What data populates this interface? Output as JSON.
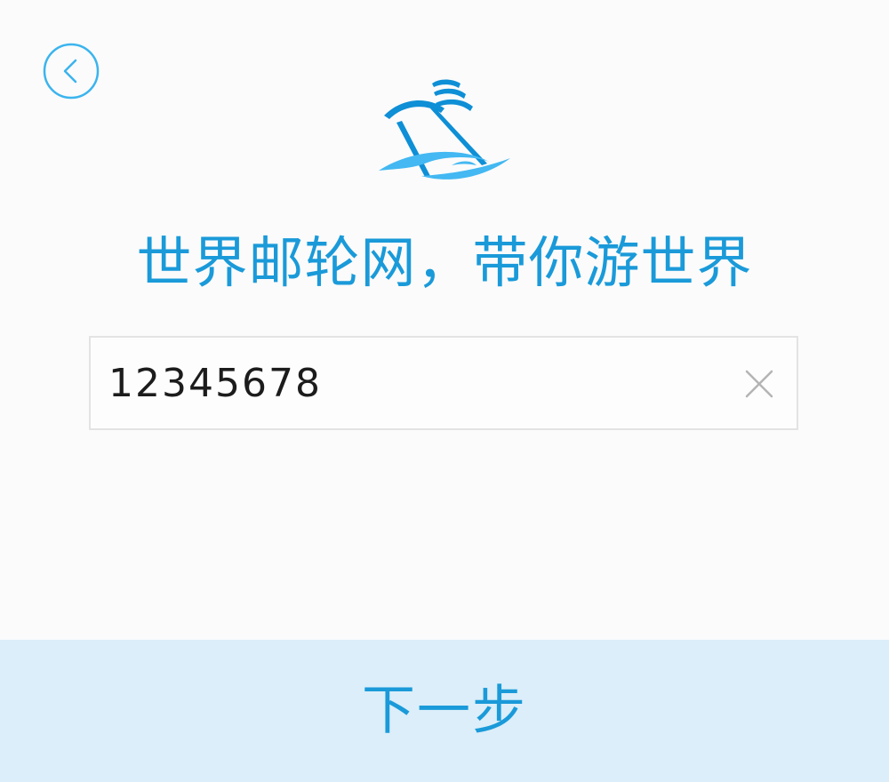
{
  "theme": {
    "accent": "#1a9ad9",
    "back_icon_color": "#3bb4ee",
    "logo_color_dark": "#0e8fd6",
    "logo_color_light": "#43b8f2",
    "clear_icon_color": "#b4b4b4",
    "next_button_bg": "#dbeef9"
  },
  "header": {
    "back_icon": "chevron-left-circle-icon",
    "logo_icon": "cruise-ship-logo-icon"
  },
  "slogan": "世界邮轮网，带你游世界",
  "phone_input": {
    "value": "12345678",
    "clear_icon": "close-icon"
  },
  "next_button": {
    "label": "下一步"
  }
}
